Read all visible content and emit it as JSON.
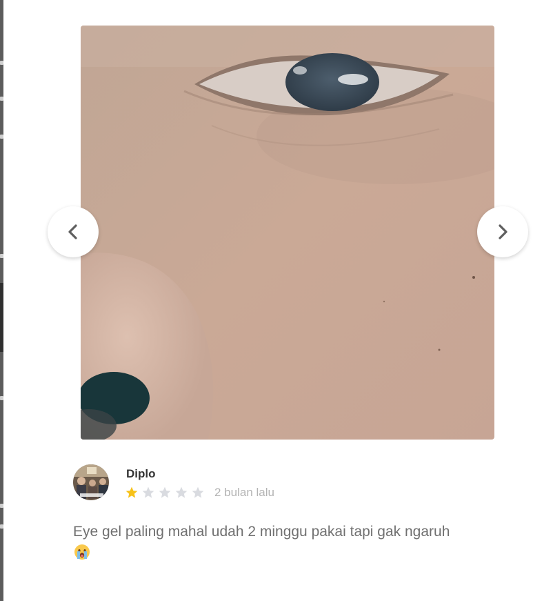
{
  "review": {
    "reviewer_name": "Diplo",
    "rating": 1,
    "max_rating": 5,
    "date": "2 bulan lalu",
    "text": "Eye gel paling mahal udah 2 minggu pakai tapi gak ngaruh",
    "emoji": "crying-face"
  },
  "gallery": {
    "photo": "close-up photo of under-eye area and nose",
    "prev_icon": "chevron-left-icon",
    "next_icon": "chevron-right-icon"
  },
  "colors": {
    "star_filled": "#f7c21a",
    "star_empty": "#d9dbe0",
    "text": "#707070",
    "name": "#333333",
    "date": "#b3b3b3"
  }
}
